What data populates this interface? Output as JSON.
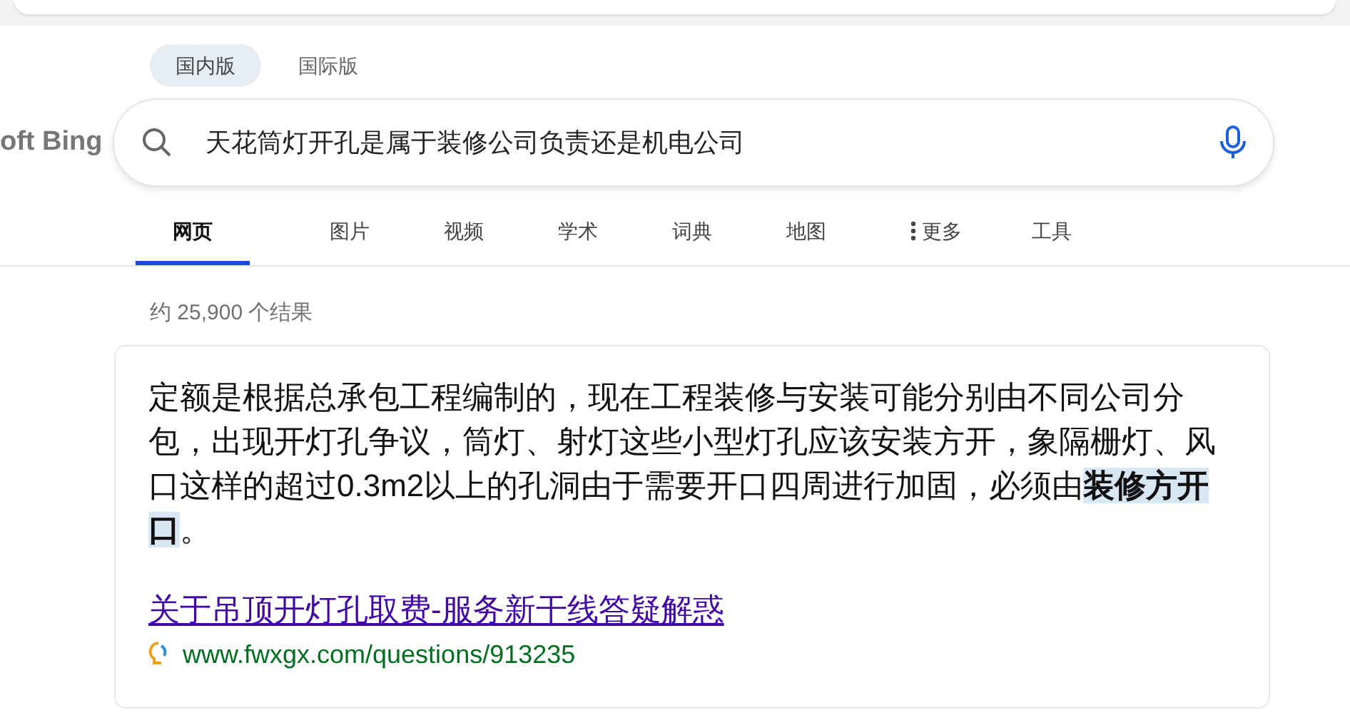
{
  "logo": {
    "text": "oft Bing"
  },
  "regions": [
    {
      "label": "国内版",
      "selected": true
    },
    {
      "label": "国际版",
      "selected": false
    }
  ],
  "search": {
    "value": "天花筒灯开孔是属于装修公司负责还是机电公司"
  },
  "tabs": [
    {
      "label": "网页",
      "selected": true,
      "kind": "tab"
    },
    {
      "label": "图片",
      "selected": false,
      "kind": "tab"
    },
    {
      "label": "视频",
      "selected": false,
      "kind": "tab"
    },
    {
      "label": "学术",
      "selected": false,
      "kind": "tab"
    },
    {
      "label": "词典",
      "selected": false,
      "kind": "tab"
    },
    {
      "label": "地图",
      "selected": false,
      "kind": "tab"
    },
    {
      "label": "更多",
      "selected": false,
      "kind": "more"
    },
    {
      "label": "工具",
      "selected": false,
      "kind": "tab"
    }
  ],
  "result_count": "约 25,900 个结果",
  "answer": {
    "text": "定额是根据总承包工程编制的，现在工程装修与安装可能分别由不同公司分包，出现开灯孔争议，筒灯、射灯这些小型灯孔应该安装方开，象隔栅灯、风口这样的超过0.3m2以上的孔洞由于需要开口四周进行加固，必须由**装修方开口**。",
    "link": "关于吊顶开灯孔取费-服务新干线答疑解惑",
    "url": "www.fwxgx.com/questions/913235"
  }
}
